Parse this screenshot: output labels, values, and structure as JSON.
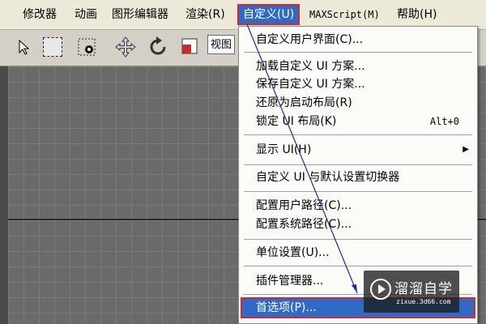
{
  "menubar": {
    "items": [
      {
        "label": "修改器"
      },
      {
        "label": "动画"
      },
      {
        "label": "图形编辑器"
      },
      {
        "label": "渲染(R)"
      },
      {
        "label": "自定义(U)"
      },
      {
        "label": "MAXScript(M)"
      },
      {
        "label": "帮助(H)"
      }
    ]
  },
  "toolbar": {
    "view_field": "视图"
  },
  "dropdown": {
    "items": [
      {
        "label": "自定义用户界面(C)..."
      },
      {
        "label": "加载自定义 UI 方案..."
      },
      {
        "label": "保存自定义 UI 方案..."
      },
      {
        "label": "还原为启动布局(R)"
      },
      {
        "label": "锁定 UI 布局(K)",
        "shortcut": "Alt+0"
      },
      {
        "label": "显示 UI(H)"
      },
      {
        "label": "自定义 UI 与默认设置切换器"
      },
      {
        "label": "配置用户路径(C)..."
      },
      {
        "label": "配置系统路径(C)..."
      },
      {
        "label": "单位设置(U)..."
      },
      {
        "label": "插件管理器..."
      },
      {
        "label": "首选项(P)..."
      }
    ]
  },
  "watermark": {
    "title": "溜溜自学",
    "url": "zixue.3d66.com"
  },
  "colors": {
    "highlight": "#316ac5",
    "annotation_red": "#d9262b",
    "annotation_arrow": "#1c2d8f"
  }
}
